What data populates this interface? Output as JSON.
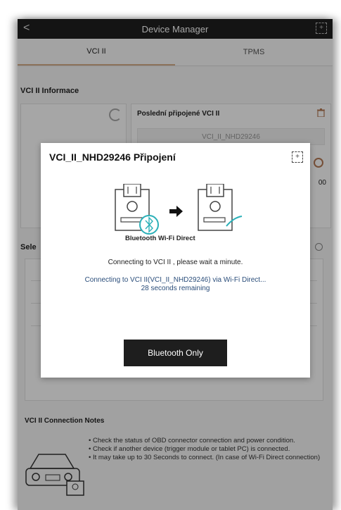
{
  "header": {
    "title": "Device Manager"
  },
  "tabs": [
    {
      "label": "VCI II"
    },
    {
      "label": "TPMS"
    }
  ],
  "section": {
    "title": "VCI II Informace"
  },
  "last_connected": {
    "title": "Poslední připojené VCI II",
    "value": "VCI_II_NHD29246",
    "side_value": "00"
  },
  "search_section": {
    "title_partial": "Sele"
  },
  "dialog": {
    "title": "VCI_II_NHD29246 Připojení",
    "modes_label": "Bluetooth Wi-Fi Direct",
    "message": "Connecting to VCI II , please wait a minute.",
    "status_line1": "Connecting to VCI II(VCI_II_NHD29246) via Wi-Fi Direct...",
    "status_line2": "28 seconds remaining",
    "button": "Bluetooth Only"
  },
  "notes": {
    "title": "VCI II Connection Notes",
    "items": [
      "• Check the status of OBD connector connection and power condition.",
      "• Check if another device (trigger module or tablet PC) is connected.",
      "• It may take up to 30 Seconds to connect. (In case of Wi-Fi Direct connection)"
    ]
  },
  "colors": {
    "accent": "#d8b08a",
    "status": "#2a4d7a",
    "topbar": "#1f1f1f"
  },
  "icons": [
    "back-icon",
    "expand-icon",
    "refresh-icon",
    "trash-icon",
    "settings-icon",
    "search-icon",
    "bluetooth-icon",
    "arrow-right-icon",
    "wifi-icon",
    "vci-device-icon",
    "car-icon"
  ]
}
